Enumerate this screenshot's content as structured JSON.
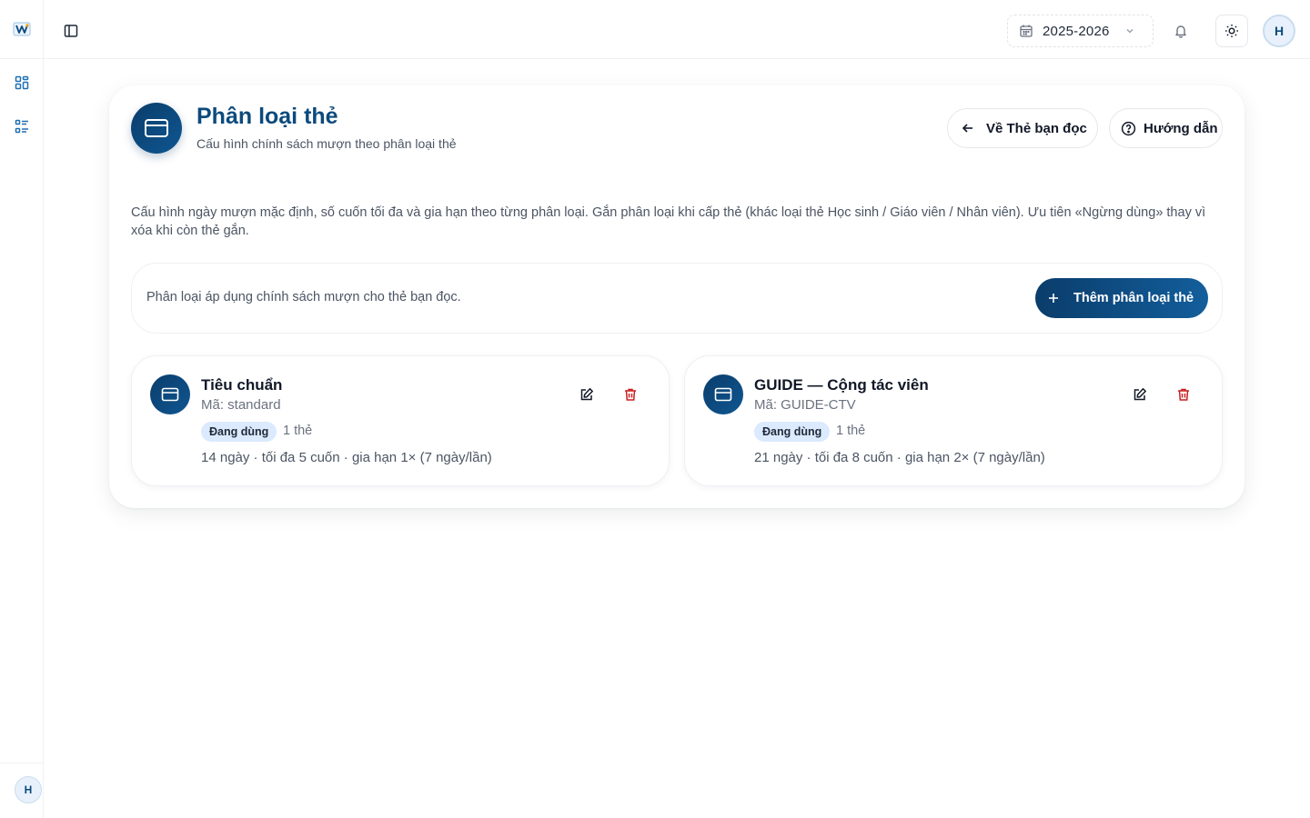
{
  "app": {
    "icons": {
      "logo": "app-logo",
      "nav": [
        "dashboard-grid-icon",
        "list-icon"
      ],
      "sidebar_toggle": "sidebar-toggle-icon",
      "bell": "bell-icon",
      "theme": "sun-icon"
    },
    "colors": {
      "primary": "#0c4a7d",
      "danger": "#c81e1e",
      "badge_bg": "#dbeafe"
    }
  },
  "topbar": {
    "school_year": "2025-2026",
    "avatar_initial": "H"
  },
  "sidebar": {
    "avatar_initial": "H"
  },
  "page": {
    "title": "Phân loại thẻ",
    "subtitle": "Cấu hình chính sách mượn theo phân loại thẻ",
    "back_button": "Về Thẻ bạn đọc",
    "guide_button": "Hướng dẫn",
    "description": "Cấu hình ngày mượn mặc định, số cuốn tối đa và gia hạn theo từng phân loại. Gắn phân loại khi cấp thẻ (khác loại thẻ Học sinh / Giáo viên / Nhân viên). Ưu tiên «Ngừng dùng» thay vì xóa khi còn thẻ gắn.",
    "info_text": "Phân loại áp dụng chính sách mượn cho thẻ bạn đọc.",
    "add_button": "Thêm phân loại thẻ"
  },
  "card_types": [
    {
      "name": "Tiêu chuẩn",
      "code": "Mã: standard",
      "status": "Đang dùng",
      "count": "1 thẻ",
      "policy": "14 ngày · tối đa 5 cuốn · gia hạn 1× (7 ngày/lần)"
    },
    {
      "name": "GUIDE — Cộng tác viên",
      "code": "Mã: GUIDE-CTV",
      "status": "Đang dùng",
      "count": "1 thẻ",
      "policy": "21 ngày · tối đa 8 cuốn · gia hạn 2× (7 ngày/lần)"
    }
  ]
}
